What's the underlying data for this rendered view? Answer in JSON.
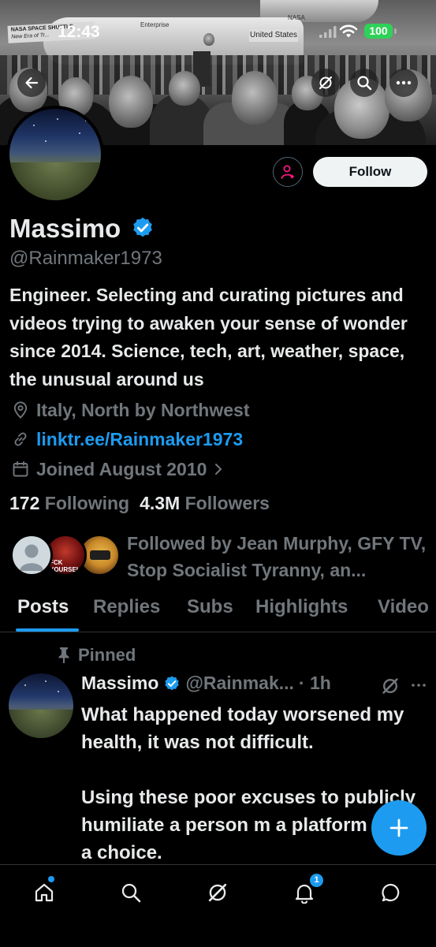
{
  "status_bar": {
    "time": "12:43",
    "battery": "100"
  },
  "banner": {
    "sign_text": "NASA SPACE SHUTTLE",
    "sign_sub": "New Era of Tr...",
    "enterprise": "Enterprise",
    "nasa": "NASA",
    "united_states": "United States",
    "badge_text": "FCK YOURSELF"
  },
  "profile": {
    "name": "Massimo",
    "handle": "@Rainmaker1973",
    "bio": "Engineer. Selecting and curating pictures and videos trying to awaken your sense of wonder since 2014. Science, tech, art, weather, space, the unusual around us",
    "location": "Italy, North by Northwest",
    "link": "linktr.ee/Rainmaker1973",
    "joined": "Joined August 2010",
    "following_count": "172",
    "following_label": "Following",
    "followers_count": "4.3M",
    "followers_label": "Followers",
    "followed_by": "Followed by Jean Murphy, GFY TV, Stop Socialist Tyranny, an..."
  },
  "actions": {
    "follow_label": "Follow"
  },
  "tabs": [
    "Posts",
    "Replies",
    "Subs",
    "Highlights",
    "Video"
  ],
  "pinned_tweet": {
    "pinned_label": "Pinned",
    "author_name": "Massimo",
    "author_handle": "@Rainmak...",
    "time": "· 1h",
    "paragraph1": "What happened today worsened my health, it was not difficult.",
    "paragraph2": "Using these poor excuses to publicly humiliate a person m a platform made a choice."
  },
  "nav": {
    "notifications_badge": "1"
  },
  "colors": {
    "accent": "#1d9bf0",
    "background": "#000000",
    "muted": "#71767b",
    "text": "#e7e9ea",
    "battery": "#30d158"
  }
}
